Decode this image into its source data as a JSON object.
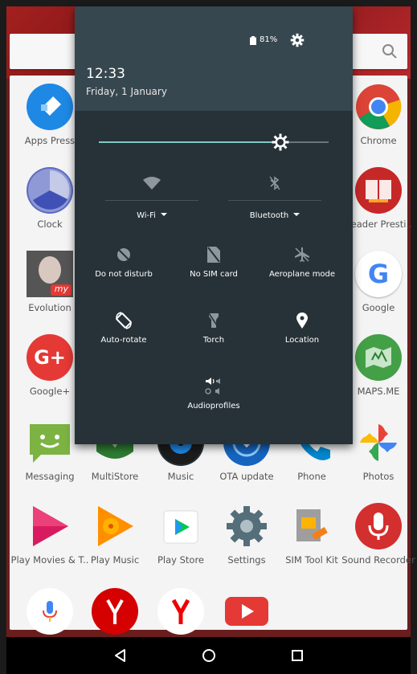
{
  "status": {
    "battery": "81%"
  },
  "shade": {
    "time": "12:33",
    "date": "Friday, 1 January",
    "brightness_level": 0.79,
    "wifi_label": "Wi-Fi",
    "bluetooth_label": "Bluetooth",
    "tiles": [
      {
        "label": "Do not disturb",
        "icon": "do-not-disturb-icon"
      },
      {
        "label": "No SIM card",
        "icon": "no-sim-icon"
      },
      {
        "label": "Aeroplane mode",
        "icon": "airplane-icon"
      },
      {
        "label": "Auto-rotate",
        "icon": "auto-rotate-icon"
      },
      {
        "label": "Torch",
        "icon": "torch-icon"
      },
      {
        "label": "Location",
        "icon": "location-icon"
      },
      {
        "label": "Audioprofiles",
        "icon": "audio-profiles-icon"
      }
    ]
  },
  "apps": {
    "left_col": [
      "Apps Press",
      "Clock",
      "Evolution",
      "Google+"
    ],
    "right_col": [
      "Chrome",
      "Reader Presti..",
      "Google",
      "MAPS.ME"
    ],
    "row5": [
      "Messaging",
      "MultiStore",
      "Music",
      "OTA update",
      "Phone",
      "Photos"
    ],
    "row6": [
      "Play Movies & T..",
      "Play Music",
      "Play Store",
      "Settings",
      "SIM Tool Kit",
      "Sound Recorder"
    ]
  },
  "evolution_badge": "my",
  "colors": {
    "shade_bg": "#263238",
    "shade_header": "#37474f",
    "accent": "#80cbc4"
  }
}
